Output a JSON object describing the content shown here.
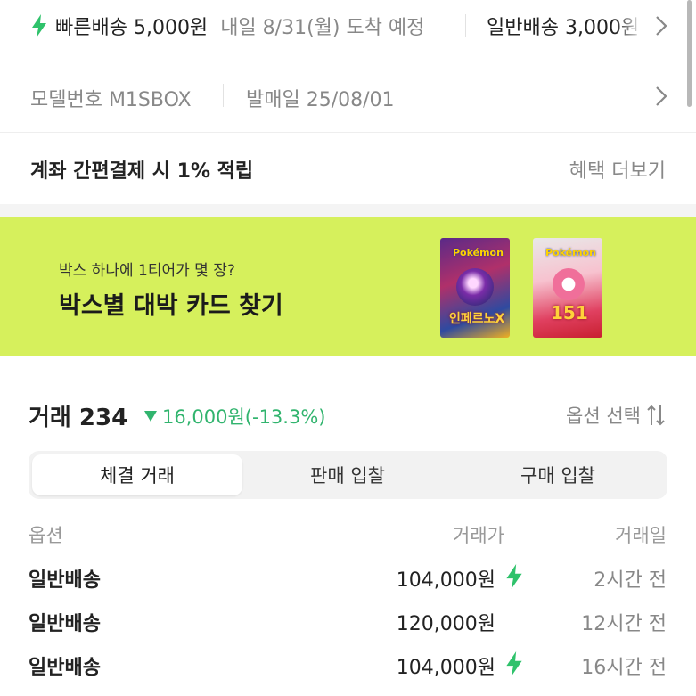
{
  "shipping": {
    "fast_label": "빠른배송 5,000원",
    "fast_eta": "내일 8/31(월) 도착 예정",
    "normal_label": "일반배송 3,000원",
    "bolt_icon": "lightning-bolt-icon",
    "chevron_icon": "chevron-right-icon"
  },
  "product_info": {
    "model_number": "모델번호 M1SBOX",
    "release_date": "발매일 25/08/01"
  },
  "benefit": {
    "text": "계좌 간편결제 시 1% 적립",
    "more_link": "혜택 더보기"
  },
  "banner": {
    "subtitle": "박스 하나에 1티어가 몇 장?",
    "title": "박스별 대박 카드 찾기",
    "background_color": "#d6f05c",
    "box1": {
      "logo": "Pokémon",
      "name": "인페르노X"
    },
    "box2": {
      "logo": "Pokémon",
      "number": "151"
    }
  },
  "trades": {
    "title": "거래 234",
    "change": "16,000원(-13.3%)",
    "change_color": "#31b46e",
    "option_select": "옵션 선택",
    "sort_icon": "sort-arrows-icon",
    "tabs": [
      {
        "label": "체결 거래",
        "active": true
      },
      {
        "label": "판매 입찰",
        "active": false
      },
      {
        "label": "구매 입찰",
        "active": false
      }
    ],
    "columns": {
      "option": "옵션",
      "price": "거래가",
      "date": "거래일"
    },
    "rows": [
      {
        "option": "일반배송",
        "price": "104,000원",
        "fast": true,
        "date": "2시간 전"
      },
      {
        "option": "일반배송",
        "price": "120,000원",
        "fast": false,
        "date": "12시간 전"
      },
      {
        "option": "일반배송",
        "price": "104,000원",
        "fast": true,
        "date": "16시간 전"
      }
    ]
  }
}
